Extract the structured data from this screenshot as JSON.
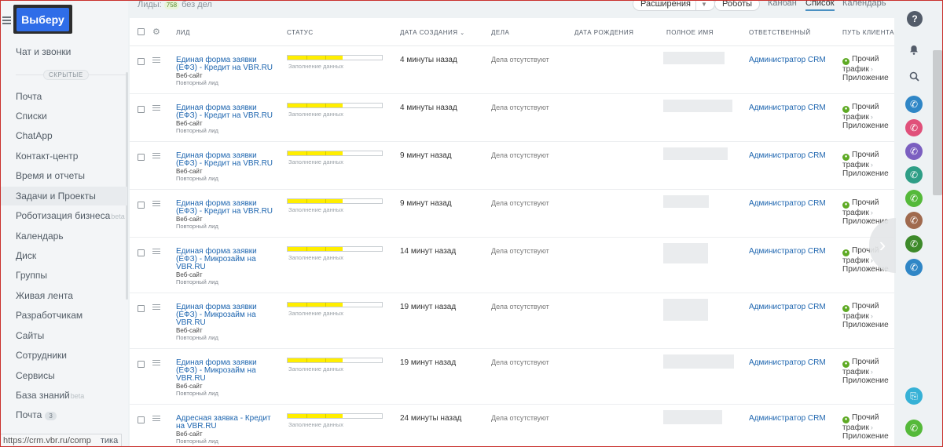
{
  "brand": {
    "logo_text": "Выбeру"
  },
  "sidebar": {
    "hidden_label": "СКРЫТЫЕ",
    "items": [
      {
        "label": "Чат и звонки"
      },
      {
        "label": "Почта"
      },
      {
        "label": "Списки"
      },
      {
        "label": "ChatApp"
      },
      {
        "label": "Контакт-центр"
      },
      {
        "label": "Время и отчеты"
      },
      {
        "label": "Задачи и Проекты"
      },
      {
        "label": "Роботизация бизнеса",
        "badge": "beta"
      },
      {
        "label": "Календарь"
      },
      {
        "label": "Диск"
      },
      {
        "label": "Группы"
      },
      {
        "label": "Живая лента"
      },
      {
        "label": "Разработчикам"
      },
      {
        "label": "Сайты"
      },
      {
        "label": "Сотрудники"
      },
      {
        "label": "Сервисы"
      },
      {
        "label": "База знаний",
        "badge": "beta"
      },
      {
        "label": "Почта",
        "count": "3"
      }
    ],
    "status_url": "https://crm.vbr.ru/comp",
    "status_url_tail": "тика"
  },
  "toolbar": {
    "leads_label": "Лиды:",
    "leads_count": "758",
    "no_deals_label": "без дел",
    "extensions_label": "Расширения",
    "robots_label": "Роботы",
    "views": [
      "Канбан",
      "Список",
      "Календарь"
    ],
    "active_view": "Список"
  },
  "grid": {
    "columns": [
      "ЛИД",
      "СТАТУС",
      "ДАТА СОЗДАНИЯ",
      "ДЕЛА",
      "ДАТА РОЖДЕНИЯ",
      "ПОЛНОЕ ИМЯ",
      "ОТВЕТСТВЕННЫЙ",
      "ПУТЬ КЛИЕНТА"
    ],
    "rows": [
      {
        "title": "Единая форма заявки (ЕФЗ) - Кредит на VBR.RU",
        "source": "Веб-сайт",
        "tag": "Повторный лид",
        "status": "Заполнение данных",
        "progress": 0.58,
        "created": "4 минуты назад",
        "deals": "Дела отсутствуют",
        "responsible": "Администратор CRM",
        "journey": [
          "Прочий трафик",
          "Приложение"
        ]
      },
      {
        "title": "Единая форма заявки (ЕФЗ) - Кредит на VBR.RU",
        "source": "Веб-сайт",
        "tag": "Повторный лид",
        "status": "Заполнение данных",
        "progress": 0.58,
        "created": "4 минуты назад",
        "deals": "Дела отсутствуют",
        "responsible": "Администратор CRM",
        "journey": [
          "Прочий трафик",
          "Приложение"
        ]
      },
      {
        "title": "Единая форма заявки (ЕФЗ) - Кредит на VBR.RU",
        "source": "Веб-сайт",
        "tag": "Повторный лид",
        "status": "Заполнение данных",
        "progress": 0.58,
        "created": "9 минут назад",
        "deals": "Дела отсутствуют",
        "responsible": "Администратор CRM",
        "journey": [
          "Прочий трафик",
          "Приложение"
        ]
      },
      {
        "title": "Единая форма заявки (ЕФЗ) - Кредит на VBR.RU",
        "source": "Веб-сайт",
        "tag": "Повторный лид",
        "status": "Заполнение данных",
        "progress": 0.58,
        "created": "9 минут назад",
        "deals": "Дела отсутствуют",
        "responsible": "Администратор CRM",
        "journey": [
          "Прочий трафик",
          "Приложение"
        ]
      },
      {
        "title": "Единая форма заявки (ЕФЗ) - Микрозайм на VBR.RU",
        "source": "Веб-сайт",
        "tag": "Повторный лид",
        "status": "Заполнение данных",
        "progress": 0.58,
        "created": "14 минут назад",
        "deals": "Дела отсутствуют",
        "responsible": "Администратор CRM",
        "journey": [
          "Прочий трафик",
          "Приложение"
        ]
      },
      {
        "title": "Единая форма заявки (ЕФЗ) - Микрозайм на VBR.RU",
        "source": "Веб-сайт",
        "tag": "Повторный лид",
        "status": "Заполнение данных",
        "progress": 0.58,
        "created": "19 минут назад",
        "deals": "Дела отсутствуют",
        "responsible": "Администратор CRM",
        "journey": [
          "Прочий трафик",
          "Приложение"
        ]
      },
      {
        "title": "Единая форма заявки (ЕФЗ) - Микрозайм на VBR.RU",
        "source": "Веб-сайт",
        "tag": "Повторный лид",
        "status": "Заполнение данных",
        "progress": 0.58,
        "created": "19 минут назад",
        "deals": "Дела отсутствуют",
        "responsible": "Администратор CRM",
        "journey": [
          "Прочий трафик",
          "Приложение"
        ]
      },
      {
        "title": "Адресная заявка - Кредит на VBR.RU",
        "source": "Веб-сайт",
        "tag": "Повторный лид",
        "status": "Заполнение данных",
        "progress": 0.58,
        "created": "24 минуты назад",
        "deals": "Дела отсутствуют",
        "responsible": "Администратор CRM",
        "journey": [
          "Прочий трафик",
          "Приложение"
        ]
      }
    ]
  },
  "right_bar": {
    "help_label": "?",
    "call_colors": [
      "#2f86c6",
      "#e0507a",
      "#7b5fc0",
      "#2e9e86",
      "#55b93a",
      "#a06a4e",
      "#3d8a2a",
      "#2f86c6"
    ],
    "app_color": "#36b1d6",
    "phone_color": "#55b93a"
  }
}
